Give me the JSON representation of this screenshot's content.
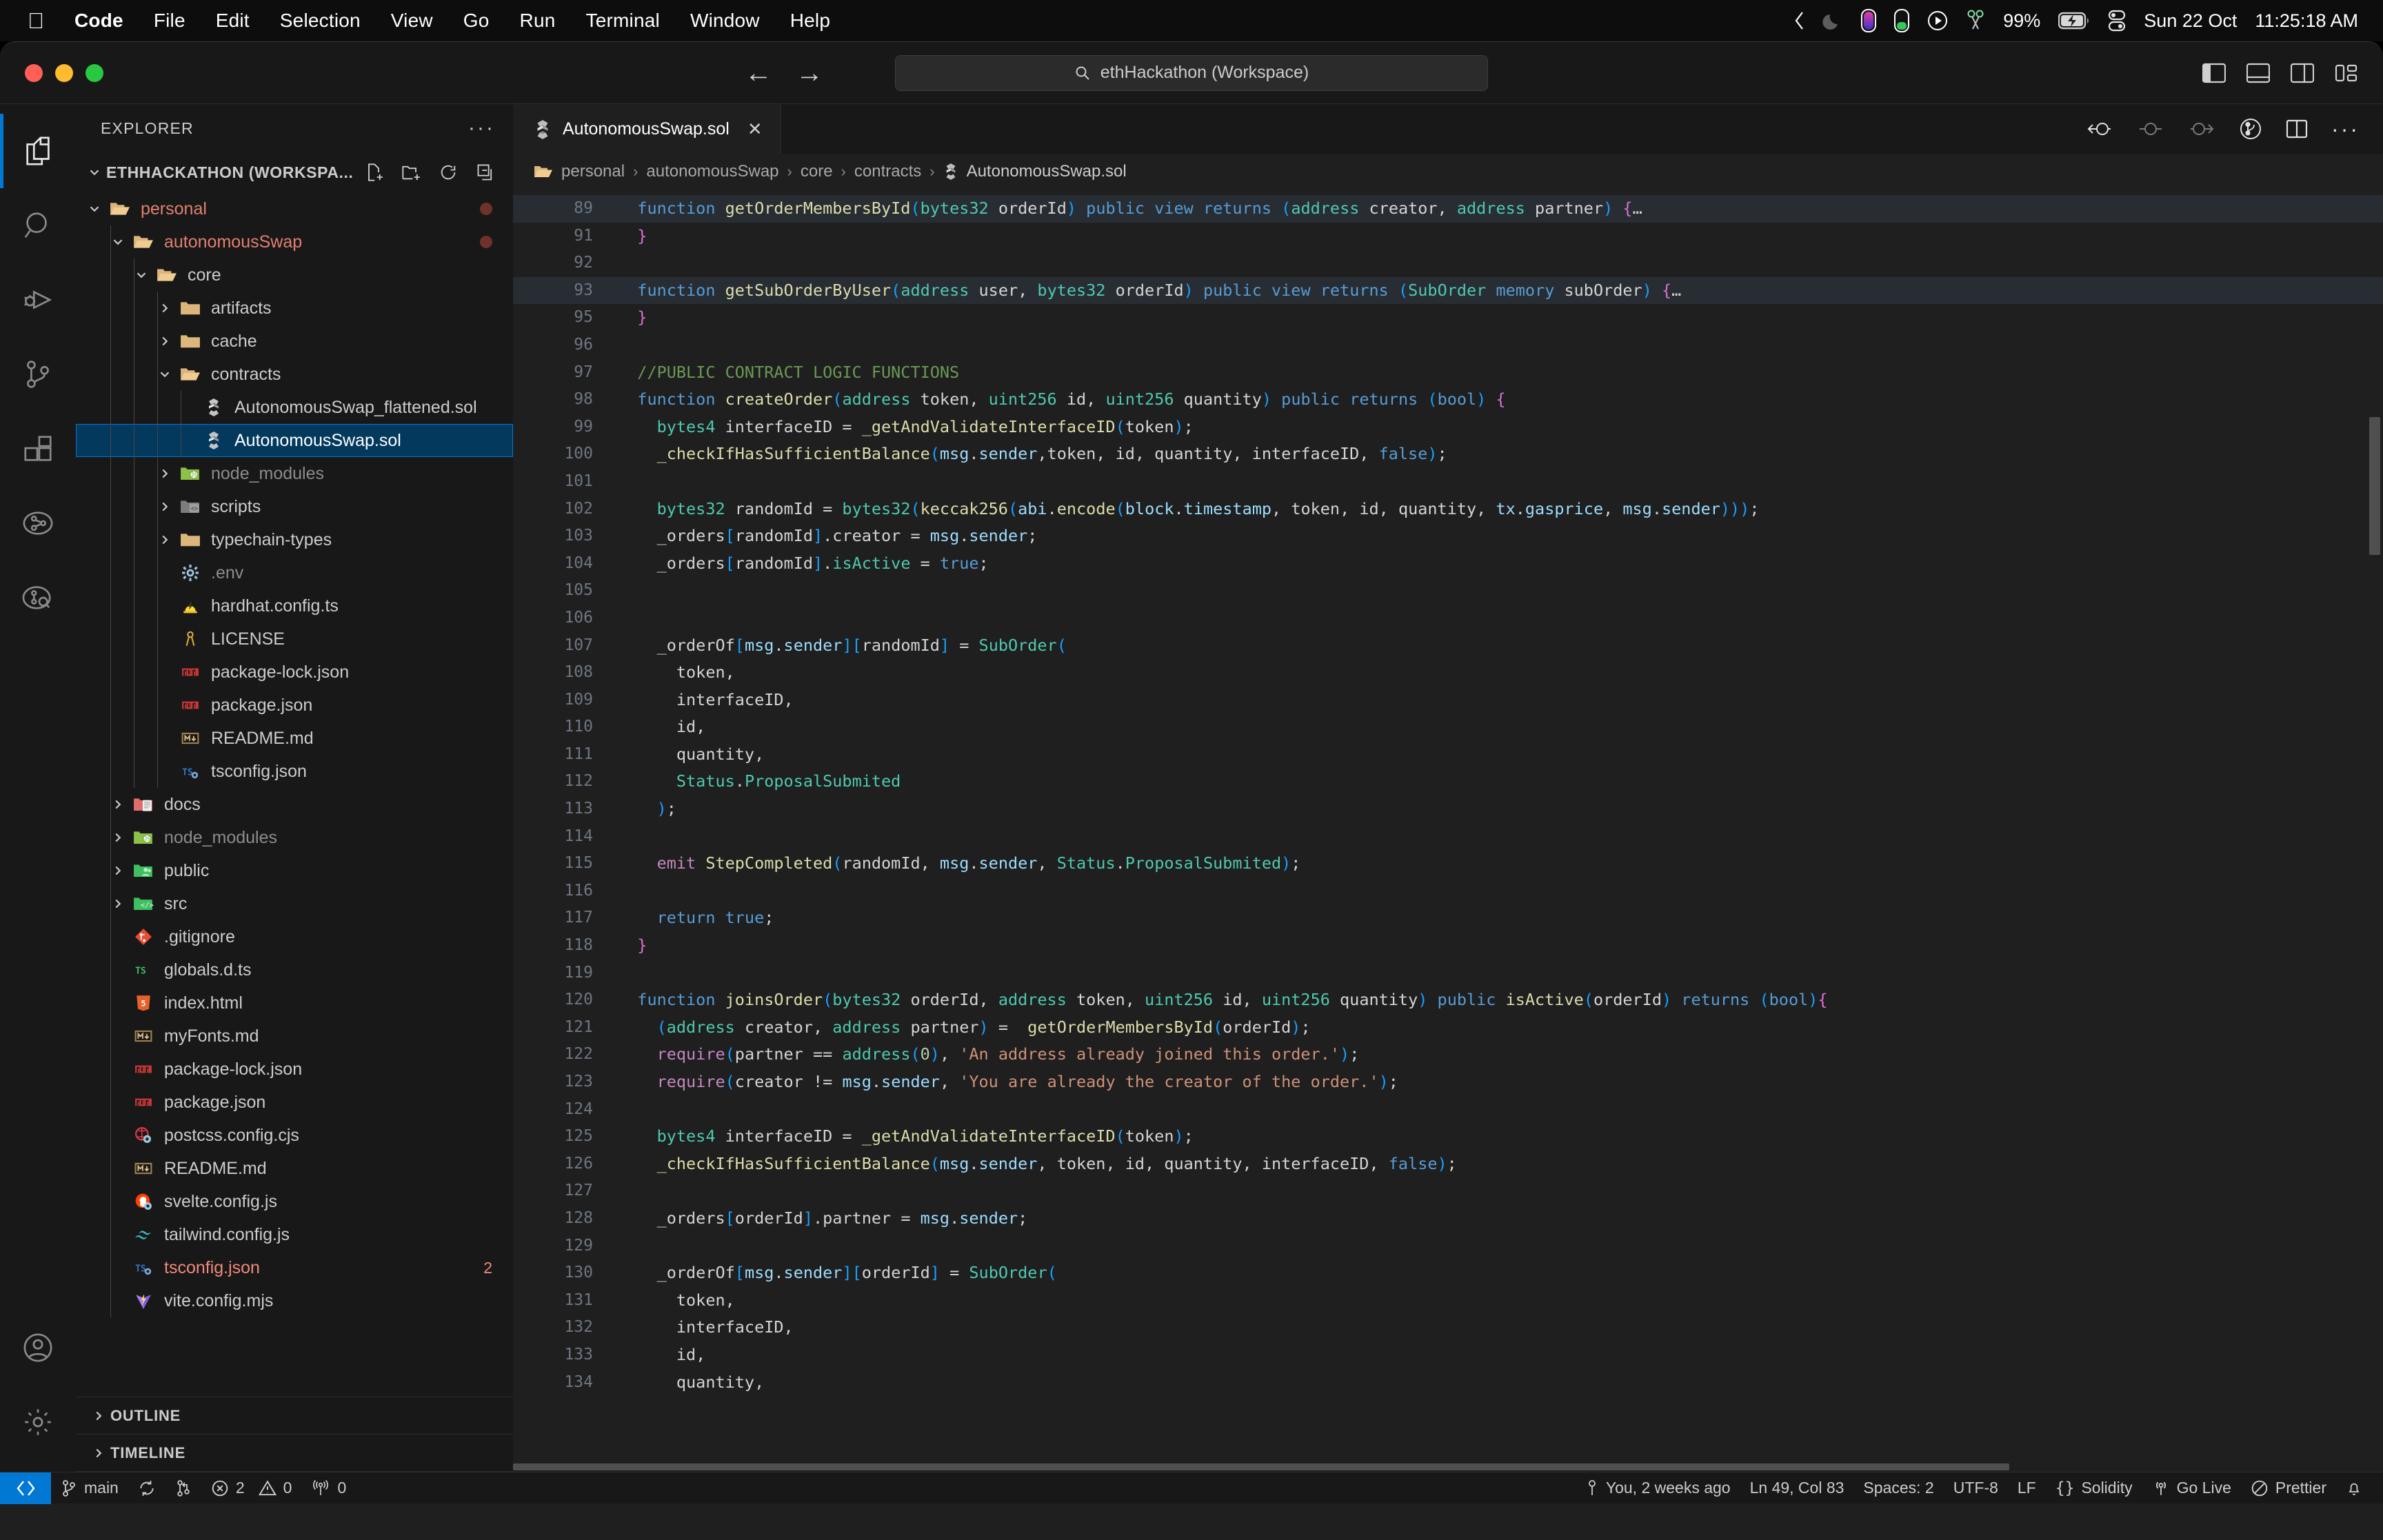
{
  "macos_menubar": {
    "apple_icon": "apple-logo-icon",
    "items": [
      {
        "label": "Code",
        "bold": true
      },
      {
        "label": "File",
        "bold": false
      },
      {
        "label": "Edit",
        "bold": false
      },
      {
        "label": "Selection",
        "bold": false
      },
      {
        "label": "View",
        "bold": false
      },
      {
        "label": "Go",
        "bold": false
      },
      {
        "label": "Run",
        "bold": false
      },
      {
        "label": "Terminal",
        "bold": false
      },
      {
        "label": "Window",
        "bold": false
      },
      {
        "label": "Help",
        "bold": false
      }
    ],
    "status_icons": [
      "chevron-left-icon",
      "moon-icon",
      "battery-pill-purple-icon",
      "battery-pill-green-icon",
      "play-circle-icon",
      "scissors-icon"
    ],
    "battery_percent": "99%",
    "battery_icon": "battery-charging-icon",
    "control_center_icon": "control-center-icon",
    "date": "Sun 22 Oct",
    "time": "11:25:18 AM"
  },
  "titlebar": {
    "traffic_lights": [
      "close",
      "minimize",
      "zoom"
    ],
    "nav_back_icon": "arrow-left-icon",
    "nav_forward_icon": "arrow-right-icon",
    "command_center": {
      "search_icon": "search-icon",
      "text": "ethHackathon (Workspace)"
    },
    "layout_buttons": [
      "toggle-primary-sidebar-icon",
      "toggle-panel-icon",
      "toggle-secondary-sidebar-icon",
      "customize-layout-icon"
    ]
  },
  "activitybar": {
    "items": [
      {
        "name": "explorer",
        "icon": "files-icon",
        "active": true
      },
      {
        "name": "search",
        "icon": "search-icon",
        "active": false
      },
      {
        "name": "run-and-debug",
        "icon": "run-debug-icon",
        "active": false
      },
      {
        "name": "source-control",
        "icon": "source-control-icon",
        "active": false
      },
      {
        "name": "extensions",
        "icon": "extensions-icon",
        "active": false
      },
      {
        "name": "testing",
        "icon": "beaker-graph-icon",
        "active": false
      },
      {
        "name": "graph-explorer",
        "icon": "graph-search-icon",
        "active": false
      }
    ],
    "bottom": [
      {
        "name": "accounts",
        "icon": "account-icon"
      },
      {
        "name": "manage",
        "icon": "gear-icon"
      }
    ]
  },
  "sidebar": {
    "title": "EXPLORER",
    "more_actions_icon": "ellipsis-icon",
    "root": {
      "label": "ETHHACKATHON (WORKSPA...",
      "twisty": "chevron-down-icon",
      "actions": [
        "new-file-icon",
        "new-folder-icon",
        "refresh-icon",
        "collapse-all-icon"
      ]
    },
    "tree": [
      {
        "label": "personal",
        "indent": 1,
        "twisty": "down",
        "icon": "folder-open-icon",
        "color": "mod",
        "dot": true
      },
      {
        "label": "autonomousSwap",
        "indent": 2,
        "twisty": "down",
        "icon": "folder-open-icon",
        "color": "mod",
        "dot": true
      },
      {
        "label": "core",
        "indent": 3,
        "twisty": "down",
        "icon": "folder-open-icon",
        "color": "",
        "dot": false
      },
      {
        "label": "artifacts",
        "indent": 4,
        "twisty": "right",
        "icon": "folder-icon",
        "color": "",
        "dot": false
      },
      {
        "label": "cache",
        "indent": 4,
        "twisty": "right",
        "icon": "folder-icon",
        "color": "",
        "dot": false
      },
      {
        "label": "contracts",
        "indent": 4,
        "twisty": "down",
        "icon": "folder-open-icon",
        "color": "",
        "dot": false
      },
      {
        "label": "AutonomousSwap_flattened.sol",
        "indent": 5,
        "twisty": "none",
        "icon": "solidity-icon",
        "color": "",
        "dot": false
      },
      {
        "label": "AutonomousSwap.sol",
        "indent": 5,
        "twisty": "none",
        "icon": "solidity-icon",
        "color": "",
        "dot": false,
        "selected": true
      },
      {
        "label": "node_modules",
        "indent": 4,
        "twisty": "right",
        "icon": "nodejs-folder-icon",
        "color": "dim",
        "dot": false
      },
      {
        "label": "scripts",
        "indent": 4,
        "twisty": "right",
        "icon": "scripts-folder-icon",
        "color": "",
        "dot": false
      },
      {
        "label": "typechain-types",
        "indent": 4,
        "twisty": "right",
        "icon": "folder-icon",
        "color": "",
        "dot": false
      },
      {
        "label": ".env",
        "indent": 4,
        "twisty": "none",
        "icon": "gear-file-icon",
        "color": "dim",
        "dot": false
      },
      {
        "label": "hardhat.config.ts",
        "indent": 4,
        "twisty": "none",
        "icon": "hardhat-icon",
        "color": "",
        "dot": false
      },
      {
        "label": "LICENSE",
        "indent": 4,
        "twisty": "none",
        "icon": "license-icon",
        "color": "",
        "dot": false
      },
      {
        "label": "package-lock.json",
        "indent": 4,
        "twisty": "none",
        "icon": "npm-icon",
        "color": "",
        "dot": false
      },
      {
        "label": "package.json",
        "indent": 4,
        "twisty": "none",
        "icon": "npm-icon",
        "color": "",
        "dot": false
      },
      {
        "label": "README.md",
        "indent": 4,
        "twisty": "none",
        "icon": "markdown-icon",
        "color": "",
        "dot": false
      },
      {
        "label": "tsconfig.json",
        "indent": 4,
        "twisty": "none",
        "icon": "tsconfig-icon",
        "color": "",
        "dot": false
      },
      {
        "label": "docs",
        "indent": 2,
        "twisty": "right",
        "icon": "docs-folder-icon",
        "color": "",
        "dot": false
      },
      {
        "label": "node_modules",
        "indent": 2,
        "twisty": "right",
        "icon": "nodejs-folder-icon",
        "color": "dim",
        "dot": false
      },
      {
        "label": "public",
        "indent": 2,
        "twisty": "right",
        "icon": "public-folder-icon",
        "color": "",
        "dot": false
      },
      {
        "label": "src",
        "indent": 2,
        "twisty": "right",
        "icon": "src-folder-icon",
        "color": "",
        "dot": false
      },
      {
        "label": ".gitignore",
        "indent": 2,
        "twisty": "none",
        "icon": "git-icon",
        "color": "",
        "dot": false
      },
      {
        "label": "globals.d.ts",
        "indent": 2,
        "twisty": "none",
        "icon": "typescript-def-icon",
        "color": "",
        "dot": false
      },
      {
        "label": "index.html",
        "indent": 2,
        "twisty": "none",
        "icon": "html5-icon",
        "color": "",
        "dot": false
      },
      {
        "label": "myFonts.md",
        "indent": 2,
        "twisty": "none",
        "icon": "markdown-icon",
        "color": "",
        "dot": false
      },
      {
        "label": "package-lock.json",
        "indent": 2,
        "twisty": "none",
        "icon": "npm-icon",
        "color": "",
        "dot": false
      },
      {
        "label": "package.json",
        "indent": 2,
        "twisty": "none",
        "icon": "npm-icon",
        "color": "",
        "dot": false
      },
      {
        "label": "postcss.config.cjs",
        "indent": 2,
        "twisty": "none",
        "icon": "postcss-icon",
        "color": "",
        "dot": false
      },
      {
        "label": "README.md",
        "indent": 2,
        "twisty": "none",
        "icon": "markdown-icon",
        "color": "",
        "dot": false
      },
      {
        "label": "svelte.config.js",
        "indent": 2,
        "twisty": "none",
        "icon": "svelte-icon",
        "color": "",
        "dot": false
      },
      {
        "label": "tailwind.config.js",
        "indent": 2,
        "twisty": "none",
        "icon": "tailwind-icon",
        "color": "",
        "dot": false
      },
      {
        "label": "tsconfig.json",
        "indent": 2,
        "twisty": "none",
        "icon": "tsconfig-icon",
        "color": "err",
        "dot": false,
        "count": "2"
      },
      {
        "label": "vite.config.mjs",
        "indent": 2,
        "twisty": "none",
        "icon": "vite-icon",
        "color": "",
        "dot": false
      }
    ],
    "sections": [
      {
        "label": "OUTLINE",
        "twisty": "right"
      },
      {
        "label": "TIMELINE",
        "twisty": "right"
      }
    ]
  },
  "editor": {
    "tab": {
      "label": "AutonomousSwap.sol",
      "icon": "solidity-icon",
      "close_icon": "close-icon"
    },
    "actions": [
      "previous-change-icon",
      "current-change-icon",
      "next-change-icon",
      "open-changes-icon",
      "split-editor-icon",
      "more-actions-icon"
    ],
    "breadcrumb": [
      {
        "label": "personal",
        "icon": "folder-open-icon"
      },
      {
        "label": "autonomousSwap",
        "icon": ""
      },
      {
        "label": "core",
        "icon": ""
      },
      {
        "label": "contracts",
        "icon": ""
      },
      {
        "label": "AutonomousSwap.sol",
        "icon": "solidity-icon"
      }
    ],
    "lines": [
      {
        "n": "89",
        "fold": true,
        "hl": true
      },
      {
        "n": "91",
        "fold": false,
        "hl": false
      },
      {
        "n": "92",
        "fold": false,
        "hl": false
      },
      {
        "n": "93",
        "fold": true,
        "hl": true
      },
      {
        "n": "95",
        "fold": false,
        "hl": false
      },
      {
        "n": "96",
        "fold": false,
        "hl": false
      },
      {
        "n": "97",
        "fold": false,
        "hl": false
      },
      {
        "n": "98",
        "fold": false,
        "hl": false
      },
      {
        "n": "99",
        "fold": false,
        "hl": false
      },
      {
        "n": "100",
        "fold": false,
        "hl": false
      },
      {
        "n": "101",
        "fold": false,
        "hl": false
      },
      {
        "n": "102",
        "fold": false,
        "hl": false
      },
      {
        "n": "103",
        "fold": false,
        "hl": false
      },
      {
        "n": "104",
        "fold": false,
        "hl": false
      },
      {
        "n": "105",
        "fold": false,
        "hl": false
      },
      {
        "n": "106",
        "fold": false,
        "hl": false
      },
      {
        "n": "107",
        "fold": false,
        "hl": false
      },
      {
        "n": "108",
        "fold": false,
        "hl": false
      },
      {
        "n": "109",
        "fold": false,
        "hl": false
      },
      {
        "n": "110",
        "fold": false,
        "hl": false
      },
      {
        "n": "111",
        "fold": false,
        "hl": false
      },
      {
        "n": "112",
        "fold": false,
        "hl": false
      },
      {
        "n": "113",
        "fold": false,
        "hl": false
      },
      {
        "n": "114",
        "fold": false,
        "hl": false
      },
      {
        "n": "115",
        "fold": false,
        "hl": false
      },
      {
        "n": "116",
        "fold": false,
        "hl": false
      },
      {
        "n": "117",
        "fold": false,
        "hl": false
      },
      {
        "n": "118",
        "fold": false,
        "hl": false
      },
      {
        "n": "119",
        "fold": false,
        "hl": false
      },
      {
        "n": "120",
        "fold": false,
        "hl": false
      },
      {
        "n": "121",
        "fold": false,
        "hl": false
      },
      {
        "n": "122",
        "fold": false,
        "hl": false
      },
      {
        "n": "123",
        "fold": false,
        "hl": false
      },
      {
        "n": "124",
        "fold": false,
        "hl": false
      },
      {
        "n": "125",
        "fold": false,
        "hl": false
      },
      {
        "n": "126",
        "fold": false,
        "hl": false
      },
      {
        "n": "127",
        "fold": false,
        "hl": false
      },
      {
        "n": "128",
        "fold": false,
        "hl": false
      },
      {
        "n": "129",
        "fold": false,
        "hl": false
      },
      {
        "n": "130",
        "fold": false,
        "hl": false
      },
      {
        "n": "131",
        "fold": false,
        "hl": false
      },
      {
        "n": "132",
        "fold": false,
        "hl": false
      },
      {
        "n": "133",
        "fold": false,
        "hl": false
      },
      {
        "n": "134",
        "fold": false,
        "hl": false
      }
    ],
    "code_text": [
      "  function getOrderMembersById(bytes32 orderId) public view returns (address creator, address partner) {…",
      "  }",
      "",
      "  function getSubOrderByUser(address user, bytes32 orderId) public view returns (SubOrder memory subOrder) {…",
      "  }",
      "",
      "  //PUBLIC CONTRACT LOGIC FUNCTIONS",
      "  function createOrder(address token, uint256 id, uint256 quantity) public returns (bool) {",
      "    bytes4 interfaceID = _getAndValidateInterfaceID(token);",
      "    _checkIfHasSufficientBalance(msg.sender,token, id, quantity, interfaceID, false);",
      "",
      "    bytes32 randomId = bytes32(keccak256(abi.encode(block.timestamp, token, id, quantity, tx.gasprice, msg.sender)));",
      "    _orders[randomId].creator = msg.sender;",
      "    _orders[randomId].isActive = true;",
      "",
      "",
      "    _orderOf[msg.sender][randomId] = SubOrder(",
      "      token,",
      "      interfaceID,",
      "      id,",
      "      quantity,",
      "      Status.ProposalSubmited",
      "    );",
      "",
      "    emit StepCompleted(randomId, msg.sender, Status.ProposalSubmited);",
      "",
      "    return true;",
      "  }",
      "",
      "  function joinsOrder(bytes32 orderId, address token, uint256 id, uint256 quantity) public isActive(orderId) returns (bool){",
      "    (address creator, address partner) =  getOrderMembersById(orderId);",
      "    require(partner == address(0), 'An address already joined this order.');",
      "    require(creator != msg.sender, 'You are already the creator of the order.');",
      "",
      "    bytes4 interfaceID = _getAndValidateInterfaceID(token);",
      "    _checkIfHasSufficientBalance(msg.sender, token, id, quantity, interfaceID, false);",
      "",
      "    _orders[orderId].partner = msg.sender;",
      "",
      "    _orderOf[msg.sender][orderId] = SubOrder(",
      "      token,",
      "      interfaceID,",
      "      id,",
      "      quantity,"
    ]
  },
  "statusbar": {
    "remote_icon": "remote-window-icon",
    "left": [
      {
        "icon": "source-control-icon",
        "label": "main"
      },
      {
        "icon": "sync-icon",
        "label": ""
      },
      {
        "icon": "git-compare-icon",
        "label": ""
      },
      {
        "icon": "error-icon",
        "label": "2",
        "icon2": "warning-icon",
        "label2": "0"
      },
      {
        "icon": "radio-tower-icon",
        "label": "0"
      }
    ],
    "errors": "2",
    "warnings": "0",
    "ports": "0",
    "right": [
      {
        "icon": "git-blame-icon",
        "label": "You, 2 weeks ago"
      },
      {
        "icon": "",
        "label": "Ln 49, Col 83"
      },
      {
        "icon": "",
        "label": "Spaces: 2"
      },
      {
        "icon": "",
        "label": "UTF-8"
      },
      {
        "icon": "",
        "label": "LF"
      },
      {
        "icon": "brackets-icon",
        "label": "Solidity"
      },
      {
        "icon": "broadcast-icon",
        "label": "Go Live"
      },
      {
        "icon": "prettier-icon",
        "label": "Prettier"
      },
      {
        "icon": "bell-icon",
        "label": ""
      }
    ]
  },
  "colors": {
    "accent": "#0078d4",
    "selection": "#04395e",
    "editor_bg": "#1f1f1f",
    "sidebar_bg": "#181818",
    "modified": "#e2806f",
    "error": "#f08a7a"
  }
}
